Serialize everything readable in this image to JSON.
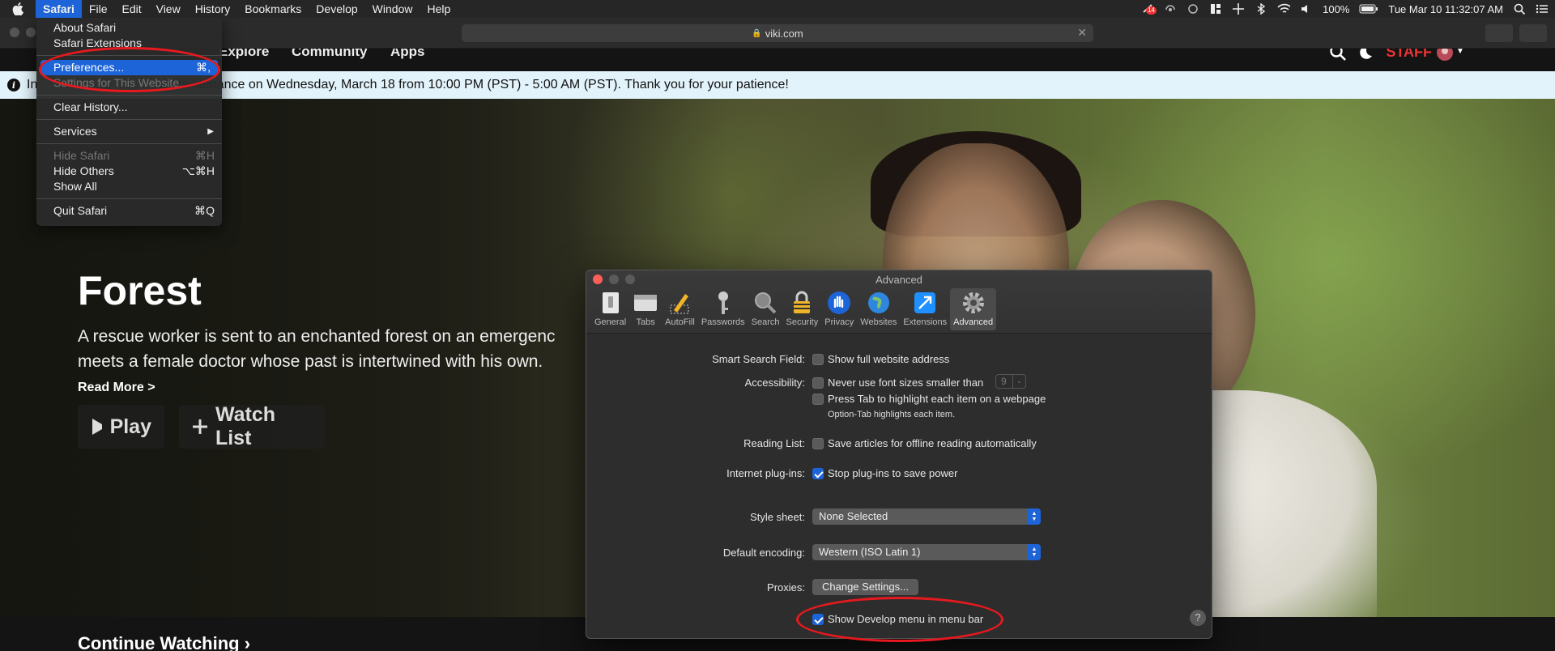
{
  "menubar": {
    "app": "Safari",
    "items": [
      "File",
      "Edit",
      "View",
      "History",
      "Bookmarks",
      "Develop",
      "Window",
      "Help"
    ],
    "badge": "14",
    "battery": "100%",
    "clock": "Tue Mar 10  11:32:07 AM"
  },
  "toolbar": {
    "url": "viki.com"
  },
  "site": {
    "nav": [
      "Explore",
      "Community",
      "Apps"
    ],
    "staff": "STAFF",
    "banner": "In                                  d maintenance on Wednesday, March 18 from 10:00 PM (PST) - 5:00 AM (PST). Thank you for your patience!",
    "hero": {
      "title": "Forest",
      "description": "A rescue worker is sent to an enchanted forest on an emergenc meets a female doctor whose past is intertwined with his own.",
      "read_more": "Read More >",
      "play": "Play",
      "watch_list": "Watch List"
    },
    "continue_watching": "Continue Watching  ›"
  },
  "appmenu": {
    "about": "About Safari",
    "extensions": "Safari Extensions",
    "preferences": "Preferences...",
    "preferences_sc": "⌘,",
    "settings_site": "Settings for This Website...",
    "clear_history": "Clear History...",
    "services": "Services",
    "hide": "Hide Safari",
    "hide_sc": "⌘H",
    "hide_others": "Hide Others",
    "hide_others_sc": "⌥⌘H",
    "show_all": "Show All",
    "quit": "Quit Safari",
    "quit_sc": "⌘Q"
  },
  "prefs": {
    "title": "Advanced",
    "tabs": [
      "General",
      "Tabs",
      "AutoFill",
      "Passwords",
      "Search",
      "Security",
      "Privacy",
      "Websites",
      "Extensions",
      "Advanced"
    ],
    "smart_search_label": "Smart Search Field:",
    "smart_search_opt": "Show full website address",
    "accessibility_label": "Accessibility:",
    "font_opt": "Never use font sizes smaller than",
    "font_size": "9",
    "tab_opt": "Press Tab to highlight each item on a webpage",
    "tab_note": "Option-Tab highlights each item.",
    "reading_label": "Reading List:",
    "reading_opt": "Save articles for offline reading automatically",
    "plugins_label": "Internet plug-ins:",
    "plugins_opt": "Stop plug-ins to save power",
    "style_label": "Style sheet:",
    "style_value": "None Selected",
    "encoding_label": "Default encoding:",
    "encoding_value": "Western (ISO Latin 1)",
    "proxies_label": "Proxies:",
    "proxies_button": "Change Settings...",
    "develop_opt": "Show Develop menu in menu bar",
    "help": "?"
  }
}
